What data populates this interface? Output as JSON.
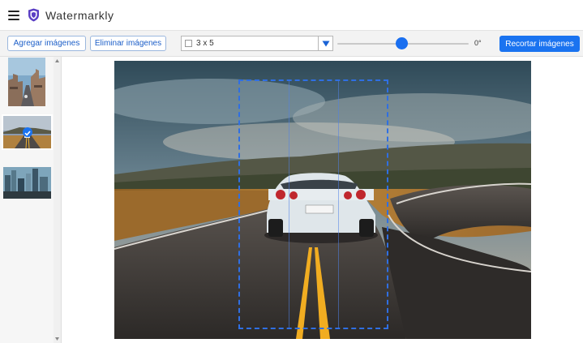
{
  "app": {
    "title": "Watermarkly",
    "brand_color": "#5b3fc4"
  },
  "toolbar": {
    "add_images_label": "Agregar imágenes",
    "remove_images_label": "Eliminar imágenes",
    "grid_value": "3 x 5",
    "angle_value": "0°",
    "slider_level": 0.49,
    "crop_label": "Recortar imágenes",
    "accent_color": "#1a73f0"
  },
  "sidebar": {
    "thumbnails": [
      {
        "name": "city-street-thumbnail",
        "selected": false
      },
      {
        "name": "road-car-thumbnail",
        "selected": true
      },
      {
        "name": "city-skyline-thumbnail",
        "selected": false
      }
    ]
  },
  "crop": {
    "columns": 3
  }
}
